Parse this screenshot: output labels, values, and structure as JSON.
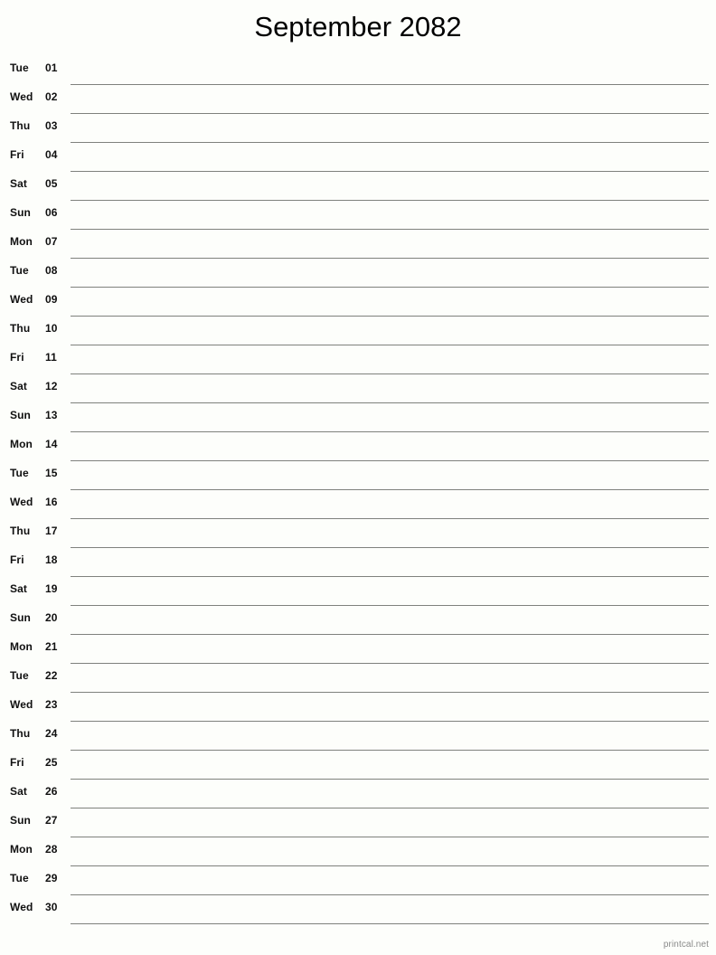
{
  "document": {
    "title": "September 2082",
    "month": "September",
    "year": "2082",
    "footer": "printcal.net",
    "line_color": "#7f817d",
    "background_color": "#fdfefb",
    "text_color": "#101010",
    "footer_color": "#8a8a8a"
  },
  "rows": [
    {
      "dayname": "Tue",
      "daynum": "01"
    },
    {
      "dayname": "Wed",
      "daynum": "02"
    },
    {
      "dayname": "Thu",
      "daynum": "03"
    },
    {
      "dayname": "Fri",
      "daynum": "04"
    },
    {
      "dayname": "Sat",
      "daynum": "05"
    },
    {
      "dayname": "Sun",
      "daynum": "06"
    },
    {
      "dayname": "Mon",
      "daynum": "07"
    },
    {
      "dayname": "Tue",
      "daynum": "08"
    },
    {
      "dayname": "Wed",
      "daynum": "09"
    },
    {
      "dayname": "Thu",
      "daynum": "10"
    },
    {
      "dayname": "Fri",
      "daynum": "11"
    },
    {
      "dayname": "Sat",
      "daynum": "12"
    },
    {
      "dayname": "Sun",
      "daynum": "13"
    },
    {
      "dayname": "Mon",
      "daynum": "14"
    },
    {
      "dayname": "Tue",
      "daynum": "15"
    },
    {
      "dayname": "Wed",
      "daynum": "16"
    },
    {
      "dayname": "Thu",
      "daynum": "17"
    },
    {
      "dayname": "Fri",
      "daynum": "18"
    },
    {
      "dayname": "Sat",
      "daynum": "19"
    },
    {
      "dayname": "Sun",
      "daynum": "20"
    },
    {
      "dayname": "Mon",
      "daynum": "21"
    },
    {
      "dayname": "Tue",
      "daynum": "22"
    },
    {
      "dayname": "Wed",
      "daynum": "23"
    },
    {
      "dayname": "Thu",
      "daynum": "24"
    },
    {
      "dayname": "Fri",
      "daynum": "25"
    },
    {
      "dayname": "Sat",
      "daynum": "26"
    },
    {
      "dayname": "Sun",
      "daynum": "27"
    },
    {
      "dayname": "Mon",
      "daynum": "28"
    },
    {
      "dayname": "Tue",
      "daynum": "29"
    },
    {
      "dayname": "Wed",
      "daynum": "30"
    }
  ]
}
